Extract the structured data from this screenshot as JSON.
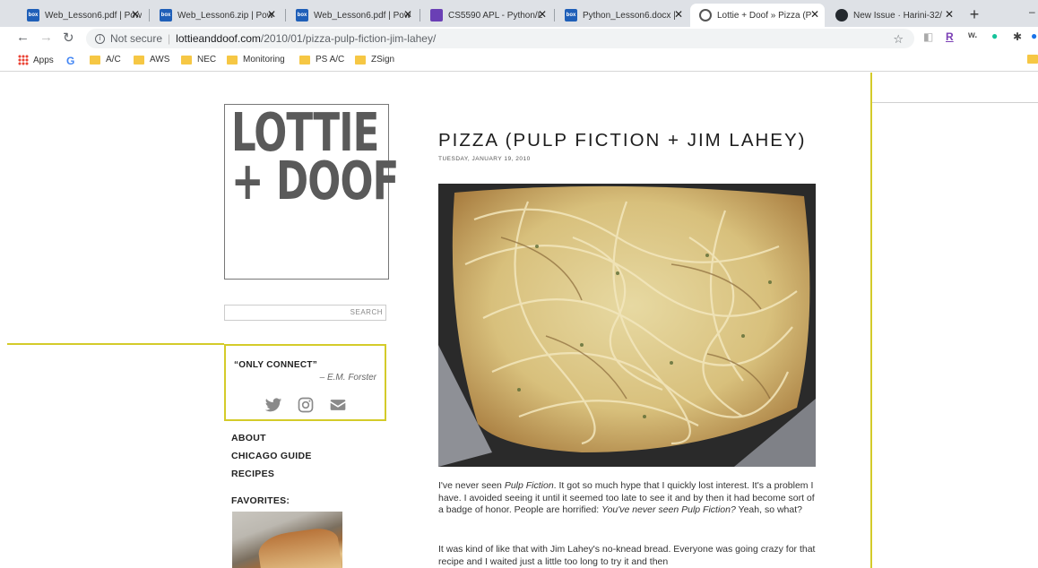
{
  "browser": {
    "tabs": [
      {
        "title": "Web_Lesson6.pdf | Pow",
        "icon": "box-icon",
        "active": false
      },
      {
        "title": "Web_Lesson6.zip | Pow",
        "icon": "box-icon",
        "active": false
      },
      {
        "title": "Web_Lesson6.pdf | Pow",
        "icon": "box-icon",
        "active": false
      },
      {
        "title": "CS5590 APL - Python/L",
        "icon": "sheet-icon",
        "active": false
      },
      {
        "title": "Python_Lesson6.docx |",
        "icon": "box-icon",
        "active": false
      },
      {
        "title": "Lottie + Doof » Pizza (P",
        "icon": "globe-icon",
        "active": true
      },
      {
        "title": "New Issue · Harini-32/",
        "icon": "github-icon",
        "active": false
      }
    ],
    "address": {
      "security": "Not secure",
      "domain": "lottieanddoof.com",
      "path": "/2010/01/pizza-pulp-fiction-jim-lahey/"
    },
    "bookmarks": [
      "Apps",
      "A/C",
      "AWS",
      "NEC",
      "Monitoring",
      "PS A/C",
      "ZSign"
    ]
  },
  "site": {
    "logo_line1": "LOTTIE",
    "logo_line2": "+ DOOF",
    "search_button": "SEARCH",
    "quote": "“ONLY CONNECT”",
    "quote_author": "– E.M. Forster",
    "nav": [
      "ABOUT",
      "CHICAGO GUIDE",
      "RECIPES"
    ],
    "favorites_label": "FAVORITES:"
  },
  "post": {
    "title": "PIZZA (PULP FICTION + JIM LAHEY)",
    "date": "TUESDAY, JANUARY 19, 2010",
    "p1": [
      {
        "t": "I've never seen "
      },
      {
        "t": "Pulp Fiction",
        "i": true
      },
      {
        "t": ". It got so much hype that I quickly lost interest. It's a problem I have. I avoided seeing it until it seemed too late to see it and by then it had become sort of a badge of honor. People are horrified: "
      },
      {
        "t": "You've never seen Pulp Fiction?",
        "i": true
      },
      {
        "t": " Yeah, so what?"
      }
    ],
    "p2": "It was kind of like that with Jim Lahey's no-knead bread. Everyone was going crazy for that recipe and I waited just a little too long to try it and then"
  },
  "colors": {
    "accent": "#d4cb2a",
    "logo": "#5a5a5a",
    "social": "#8a8a8a"
  }
}
